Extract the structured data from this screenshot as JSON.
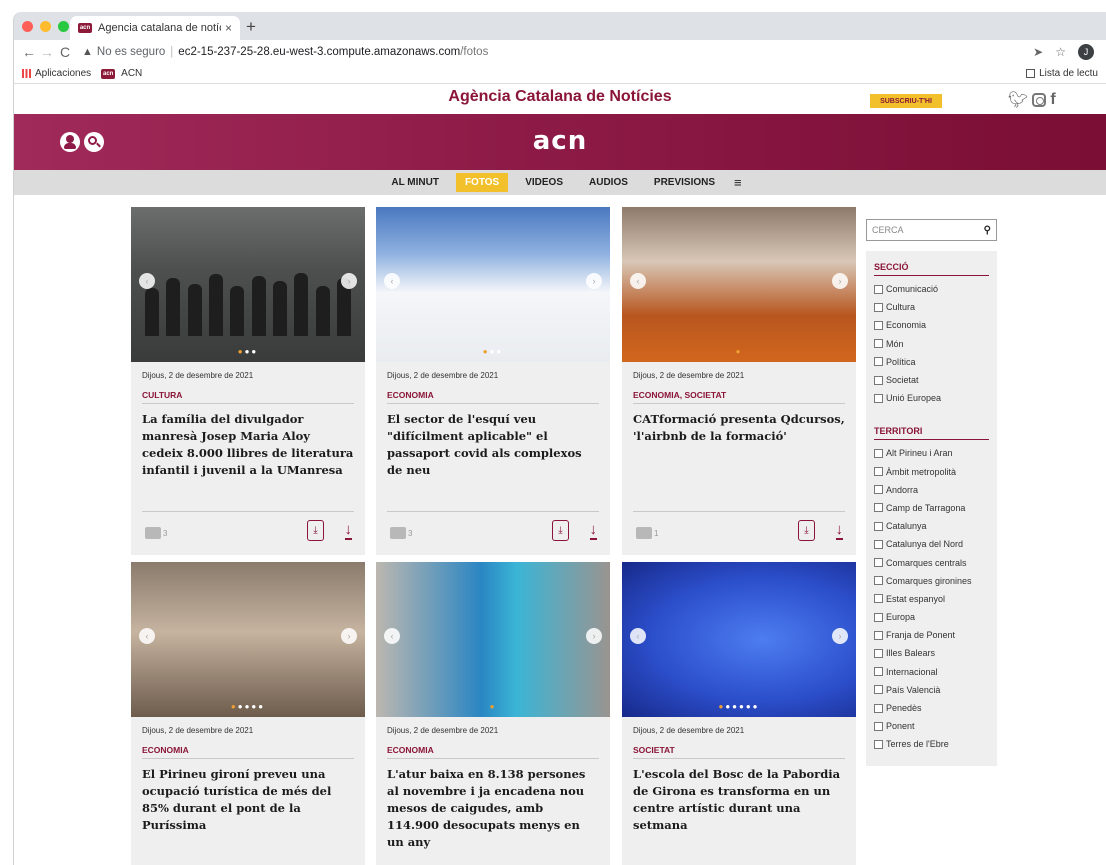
{
  "browser": {
    "tab_title": "Agencia catalana de notícies",
    "tab_close": "×",
    "new_tab": "+",
    "url_warning": "No es seguro",
    "url_host": "ec2-15-237-25-28.eu-west-3.compute.amazonaws.com",
    "url_path": "/fotos",
    "bookmarks": [
      "Aplicaciones",
      "ACN"
    ],
    "reading_list": "Lista de lectu",
    "profile_initial": "J",
    "favicon_text": "acn"
  },
  "site": {
    "name": "Agència Catalana de Notícies",
    "subscribe": "SUBSCRIU-T'HI",
    "logo": "acn",
    "menu": [
      "AL MINUT",
      "FOTOS",
      "VIDEOS",
      "AUDIOS",
      "PREVISIONS"
    ],
    "menu_active": "FOTOS",
    "menu_more": "≡"
  },
  "cards": [
    {
      "date": "Dijous, 2 de desembre de 2021",
      "category": "CULTURA",
      "title": "La família del divulgador manresà Josep Maria Aloy cedeix 8.000 llibres de literatura infantil i juvenil a la UManresa",
      "photos": "3"
    },
    {
      "date": "Dijous, 2 de desembre de 2021",
      "category": "ECONOMIA",
      "title": "El sector de l'esquí veu \"difícilment aplicable\" el passaport covid als complexos de neu",
      "photos": "3"
    },
    {
      "date": "Dijous, 2 de desembre de 2021",
      "category": "ECONOMIA, SOCIETAT",
      "title": "CATformació presenta Qdcursos, 'l'airbnb de la formació'",
      "photos": "1"
    },
    {
      "date": "Dijous, 2 de desembre de 2021",
      "category": "ECONOMIA",
      "title": "El Pirineu gironí preveu una ocupació turística de més del 85% durant el pont de la Puríssima",
      "photos": ""
    },
    {
      "date": "Dijous, 2 de desembre de 2021",
      "category": "ECONOMIA",
      "title": "L'atur baixa en 8.138 persones al novembre i ja encadena nou mesos de caigudes, amb 114.900 desocupats menys en un any",
      "photos": ""
    },
    {
      "date": "Dijous, 2 de desembre de 2021",
      "category": "SOCIETAT",
      "title": "L'escola del Bosc de la Pabordia de Girona es transforma en un centre artístic durant una setmana",
      "photos": ""
    }
  ],
  "sidebar": {
    "search_placeholder": "CERCA",
    "section_title": "SECCIÓ",
    "sections": [
      "Comunicació",
      "Cultura",
      "Economia",
      "Món",
      "Política",
      "Societat",
      "Unió Europea"
    ],
    "territory_title": "TERRITORI",
    "territories": [
      "Alt Pirineu i Aran",
      "Àmbit metropolità",
      "Andorra",
      "Camp de Tarragona",
      "Catalunya",
      "Catalunya del Nord",
      "Comarques centrals",
      "Comarques gironines",
      "Estat espanyol",
      "Europa",
      "Franja de Ponent",
      "Illes Balears",
      "Internacional",
      "País Valencià",
      "Penedès",
      "Ponent",
      "Terres de l'Ebre"
    ]
  },
  "colors": {
    "brand": "#8a1538",
    "accent": "#f2c02b",
    "menu_bg": "#dcdcdc",
    "card_bg": "#efefef"
  }
}
